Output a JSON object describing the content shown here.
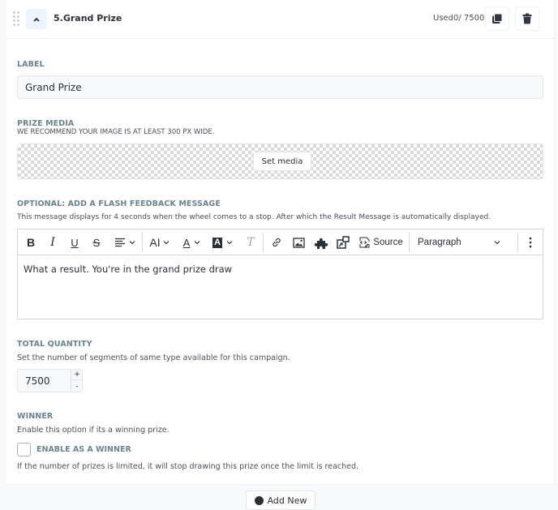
{
  "header": {
    "title": "5.Grand Prize",
    "used_text": "Used0/ 7500",
    "icons": {
      "drag": "drag-handle-icon",
      "collapse": "chevron-up-icon",
      "duplicate": "copy-icon",
      "delete": "trash-icon"
    }
  },
  "label_section": {
    "heading": "LABEL",
    "value": "Grand Prize"
  },
  "media_section": {
    "heading": "PRIZE MEDIA",
    "hint": "WE RECOMMEND YOUR IMAGE IS AT LEAST 300 PX WIDE.",
    "button_label": "Set media"
  },
  "feedback_section": {
    "heading": "OPTIONAL: ADD A FLASH FEEDBACK MESSAGE",
    "hint": "This message displays for 4 seconds when the wheel comes to a stop. After which the Result Message is automatically displayed.",
    "toolbar": {
      "bold": "B",
      "italic": "I",
      "underline": "U",
      "strikethrough": "S",
      "font_size": "AI",
      "font_color": "A",
      "bg_color": "A",
      "remove_format": "T",
      "source_label": "Source",
      "heading_select": "Paragraph"
    },
    "content": "What a result. You're in the grand prize draw"
  },
  "quantity_section": {
    "heading": "TOTAL QUANTITY",
    "hint": "Set the number of segments of same type available for this campaign.",
    "value": "7500",
    "plus": "+",
    "minus": "-"
  },
  "winner_section": {
    "heading": "WINNER",
    "hint": "Enable this option if its a winning prize.",
    "checkbox_label": "ENABLE AS A WINNER",
    "checked": false,
    "footer_note": "If the number of prizes is limited, it will stop drawing this prize once the limit is reached."
  },
  "add_new": {
    "label": "Add New"
  }
}
